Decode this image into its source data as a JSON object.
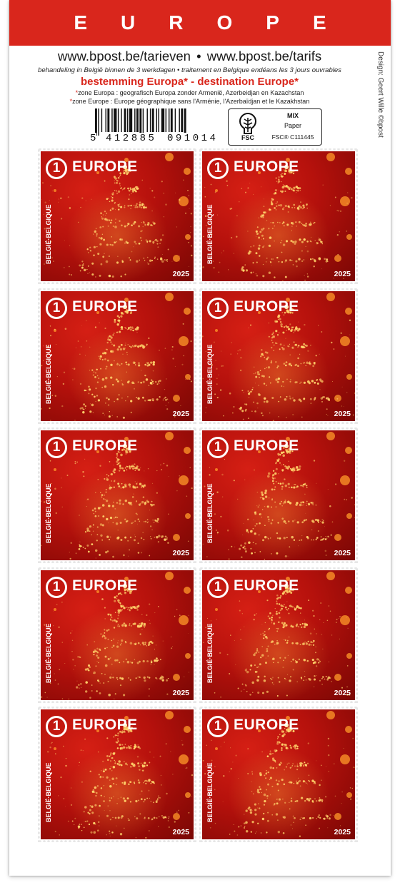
{
  "header": {
    "banner_title": "EUROPE",
    "banner_color": "#d9261c",
    "url_nl": "www.bpost.be/tarieven",
    "url_fr": "www.bpost.be/tarifs",
    "handling_nl": "behandeling in België binnen de 3 werkdagen",
    "handling_fr": "traitement en Belgique endéans les 3 jours ouvrables",
    "destination_line": "bestemming Europa* - destination Europe*",
    "zone_nl": "zone Europa : geografisch Europa zonder Armenië, Azerbeidjan en Kazachstan",
    "zone_fr": "zone Europe : Europe géographique sans l'Arménie, l'Azerbaïdjan et le Kazakhstan",
    "designer_credit": "Design: Geert Wille ©bpost"
  },
  "barcode": {
    "lead_digit": "5",
    "left_group": "412885",
    "right_group": "091014"
  },
  "fsc": {
    "logo_icon": "fsc-tree-icon",
    "logo_text": "FSC",
    "line1": "MIX",
    "line2": "Paper",
    "line3": "FSC® C111445"
  },
  "stamp": {
    "denomination": "1",
    "destination": "EUROPE",
    "country": "BELGIË·BELGIQUE",
    "year": "2025",
    "count": 10,
    "background_color": "#c0140c",
    "sparkle_color": "#ffd36b"
  }
}
